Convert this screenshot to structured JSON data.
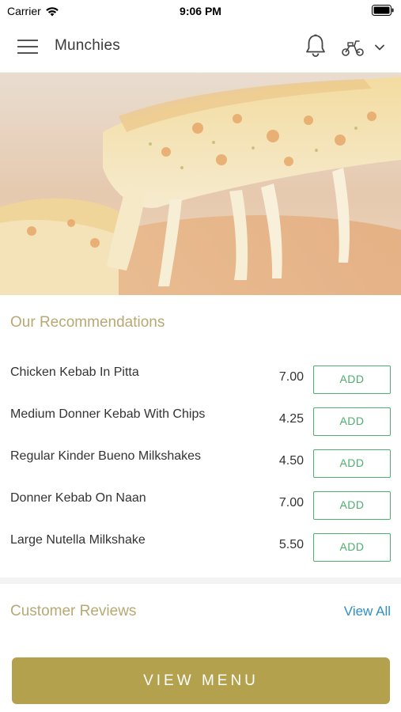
{
  "status_bar": {
    "carrier": "Carrier",
    "time": "9:06 PM"
  },
  "app_bar": {
    "title": "Munchies",
    "icons": [
      "menu-icon",
      "bell-icon",
      "scooter-icon",
      "chevron-down-icon"
    ]
  },
  "recommendations": {
    "title": "Our Recommendations",
    "items": [
      {
        "name": "Chicken Kebab In Pitta",
        "price": "7.00",
        "action": "ADD"
      },
      {
        "name": "Medium Donner Kebab With Chips",
        "price": "4.25",
        "action": "ADD"
      },
      {
        "name": "Regular Kinder Bueno Milkshakes",
        "price": "4.50",
        "action": "ADD"
      },
      {
        "name": "Donner Kebab On Naan",
        "price": "7.00",
        "action": "ADD"
      },
      {
        "name": "Large Nutella Milkshake",
        "price": "5.50",
        "action": "ADD"
      }
    ]
  },
  "reviews": {
    "title": "Customer Reviews",
    "view_all": "View All"
  },
  "footer": {
    "view_menu": "VIEW MENU"
  },
  "colors": {
    "accent_gold": "#b3a14e",
    "heading_gold": "#b8a873",
    "add_green": "#4caf6e",
    "link_blue": "#2e8fc7"
  }
}
